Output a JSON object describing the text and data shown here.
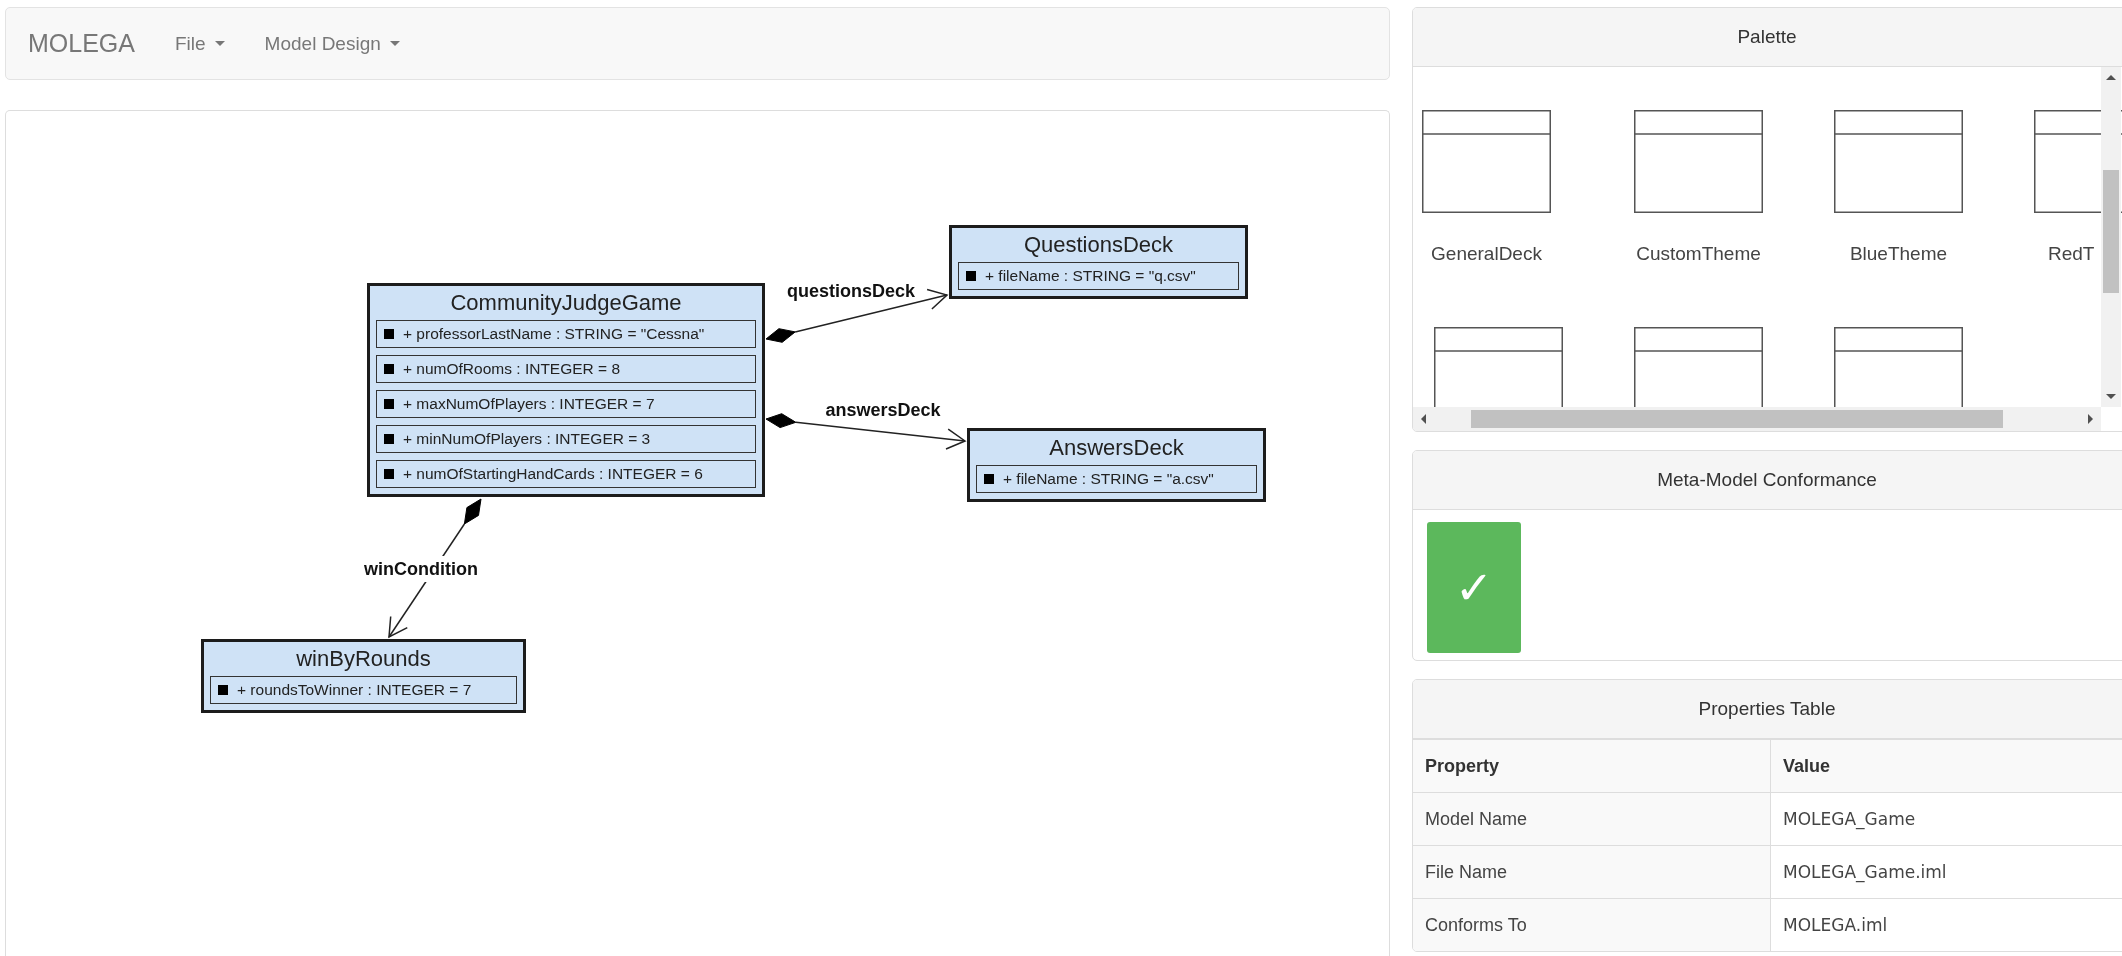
{
  "navbar": {
    "brand": "MOLEGA",
    "menus": [
      {
        "label": "File"
      },
      {
        "label": "Model Design"
      }
    ]
  },
  "diagram": {
    "classes": [
      {
        "name": "CommunityJudgeGame",
        "attributes": [
          "+ professorLastName : STRING = \"Cessna\"",
          "+ numOfRooms : INTEGER = 8",
          "+ maxNumOfPlayers : INTEGER = 7",
          "+ minNumOfPlayers : INTEGER = 3",
          "+ numOfStartingHandCards : INTEGER = 6"
        ]
      },
      {
        "name": "QuestionsDeck",
        "attributes": [
          "+ fileName : STRING = \"q.csv\""
        ]
      },
      {
        "name": "AnswersDeck",
        "attributes": [
          "+ fileName : STRING = \"a.csv\""
        ]
      },
      {
        "name": "winByRounds",
        "attributes": [
          "+ roundsToWinner : INTEGER = 7"
        ]
      }
    ],
    "associations": [
      {
        "label": "questionsDeck"
      },
      {
        "label": "answersDeck"
      },
      {
        "label": "winCondition"
      }
    ]
  },
  "palette": {
    "title": "Palette",
    "items": [
      {
        "label": "GeneralDeck"
      },
      {
        "label": "CustomTheme"
      },
      {
        "label": "BlueTheme"
      },
      {
        "label": "RedT"
      }
    ]
  },
  "conformance": {
    "title": "Meta-Model Conformance",
    "conforms": true,
    "mark": "✓"
  },
  "properties": {
    "title": "Properties Table",
    "columns": [
      "Property",
      "Value"
    ],
    "rows": [
      {
        "property": "Model Name",
        "value": "MOLEGA_Game"
      },
      {
        "property": "File Name",
        "value": "MOLEGA_Game.iml"
      },
      {
        "property": "Conforms To",
        "value": "MOLEGA.iml"
      }
    ]
  }
}
